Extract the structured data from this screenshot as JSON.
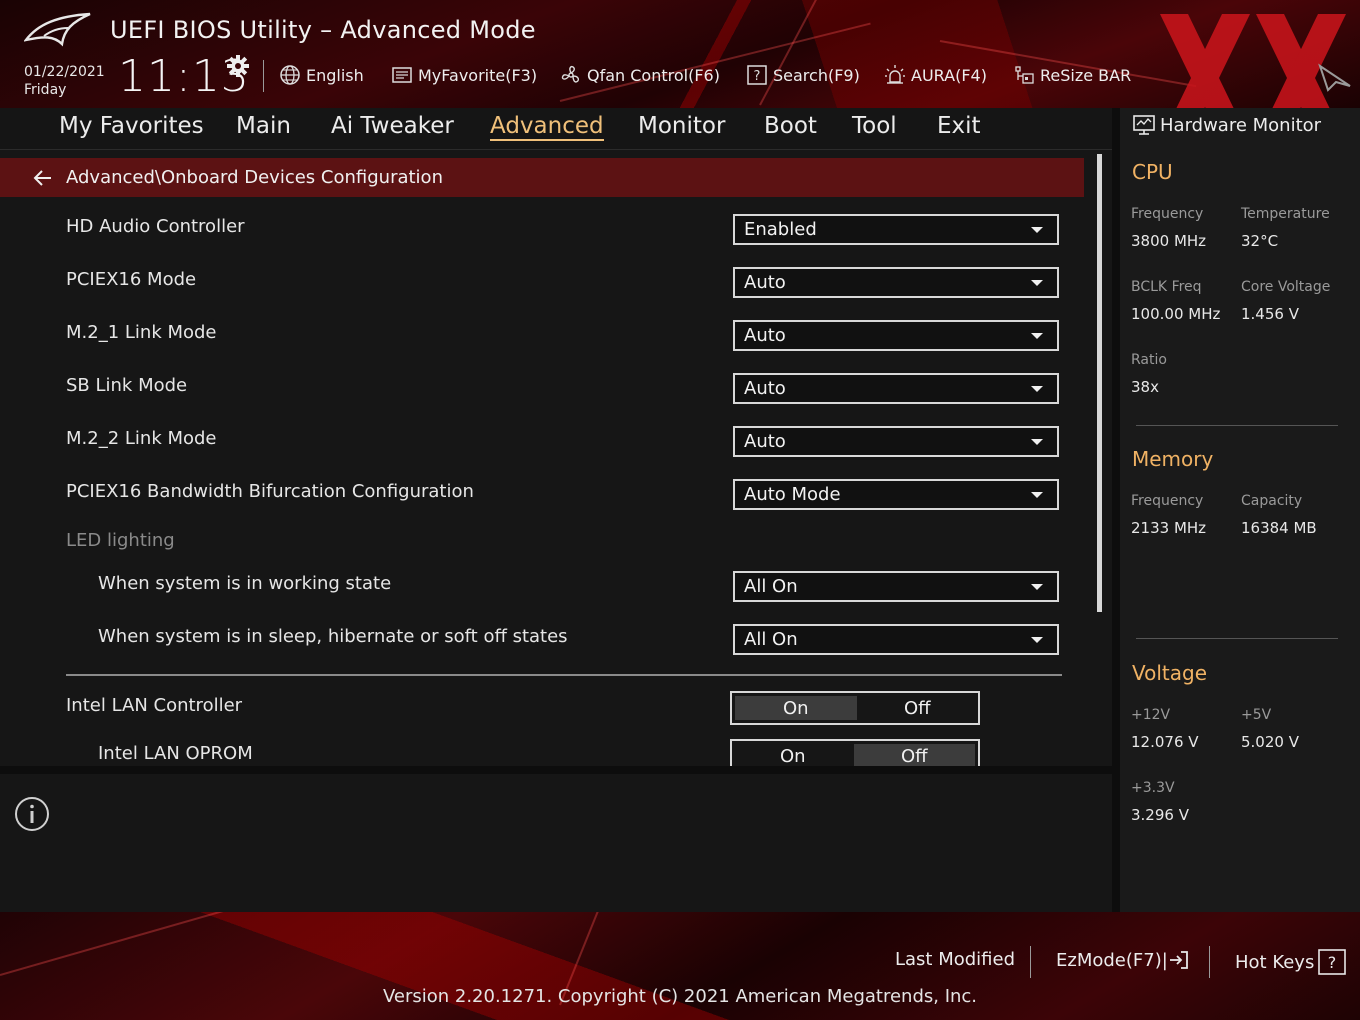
{
  "header": {
    "app_title": "UEFI BIOS Utility – Advanced Mode",
    "date": "01/22/2021",
    "day": "Friday",
    "time": "11:13",
    "tools": {
      "language": "English",
      "favorite": "MyFavorite(F3)",
      "qfan": "Qfan Control(F6)",
      "search": "Search(F9)",
      "aura": "AURA(F4)",
      "resize_bar": "ReSize BAR"
    }
  },
  "menu": {
    "favorites": "My Favorites",
    "main": "Main",
    "ai_tweaker": "Ai Tweaker",
    "advanced": "Advanced",
    "monitor": "Monitor",
    "boot": "Boot",
    "tool": "Tool",
    "exit": "Exit",
    "active": "Advanced"
  },
  "breadcrumb": "Advanced\\Onboard Devices Configuration",
  "settings": {
    "hd_audio": {
      "label": "HD Audio Controller",
      "value": "Enabled"
    },
    "pciex16_mode": {
      "label": "PCIEX16 Mode",
      "value": "Auto"
    },
    "m2_1": {
      "label": "M.2_1 Link Mode",
      "value": "Auto"
    },
    "sb_link": {
      "label": "SB Link Mode",
      "value": "Auto"
    },
    "m2_2": {
      "label": "M.2_2 Link Mode",
      "value": "Auto"
    },
    "bifurcation": {
      "label": "PCIEX16 Bandwidth Bifurcation Configuration",
      "value": "Auto Mode"
    },
    "led_section": "LED lighting",
    "led_working": {
      "label": "When system is in working state",
      "value": "All On"
    },
    "led_sleep": {
      "label": "When system is in sleep, hibernate or soft off states",
      "value": "All On"
    },
    "intel_lan": {
      "label": "Intel LAN Controller",
      "on": "On",
      "off": "Off",
      "selected": "On"
    },
    "intel_lan_oprom": {
      "label": "Intel LAN OPROM",
      "on": "On",
      "off": "Off",
      "selected": "Off"
    }
  },
  "hardware_monitor": {
    "title": "Hardware Monitor",
    "cpu": {
      "title": "CPU",
      "frequency_label": "Frequency",
      "frequency": "3800 MHz",
      "temperature_label": "Temperature",
      "temperature": "32°C",
      "bclk_label": "BCLK Freq",
      "bclk": "100.00 MHz",
      "core_voltage_label": "Core Voltage",
      "core_voltage": "1.456 V",
      "ratio_label": "Ratio",
      "ratio": "38x"
    },
    "memory": {
      "title": "Memory",
      "frequency_label": "Frequency",
      "frequency": "2133 MHz",
      "capacity_label": "Capacity",
      "capacity": "16384 MB"
    },
    "voltage": {
      "title": "Voltage",
      "v12_label": "+12V",
      "v12": "12.076 V",
      "v5_label": "+5V",
      "v5": "5.020 V",
      "v33_label": "+3.3V",
      "v33": "3.296 V"
    }
  },
  "footer": {
    "last_modified": "Last Modified",
    "ezmode": "EzMode(F7)|",
    "hot_keys": "Hot Keys",
    "version": "Version 2.20.1271. Copyright (C) 2021 American Megatrends, Inc."
  },
  "colors": {
    "accent": "#f0c07a",
    "hwm_section": "#f0b264",
    "breadcrumb_bg": "#5c1213"
  }
}
